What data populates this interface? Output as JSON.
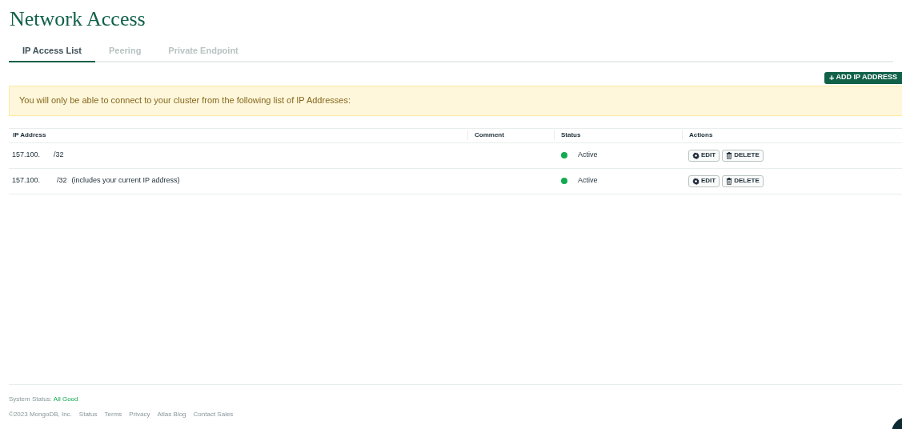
{
  "page": {
    "title": "Network Access"
  },
  "tabs": [
    {
      "label": "IP Access List",
      "selected": true
    },
    {
      "label": "Peering",
      "selected": false
    },
    {
      "label": "Private Endpoint",
      "selected": false
    }
  ],
  "add_button": {
    "icon": "+",
    "label": "ADD IP ADDRESS"
  },
  "banner": {
    "text": "You will only be able to connect to your cluster from the following list of IP Addresses:"
  },
  "table": {
    "columns": [
      "IP Address",
      "Comment",
      "Status",
      "Actions"
    ],
    "rows": [
      {
        "ip_prefix": "157.100.",
        "ip_suffix": "/32",
        "note": "",
        "status": "Active",
        "actions": [
          "EDIT",
          "DELETE"
        ]
      },
      {
        "ip_prefix": "157.100.",
        "ip_suffix": "/32",
        "note": "(includes your current IP address)",
        "status": "Active",
        "actions": [
          "EDIT",
          "DELETE"
        ]
      }
    ]
  },
  "footer": {
    "status_label": "System Status:",
    "status_value": "All Good",
    "copyright": "©2023 MongoDB, Inc.",
    "links": [
      "Status",
      "Terms",
      "Privacy",
      "Atlas Blog",
      "Contact Sales"
    ]
  }
}
